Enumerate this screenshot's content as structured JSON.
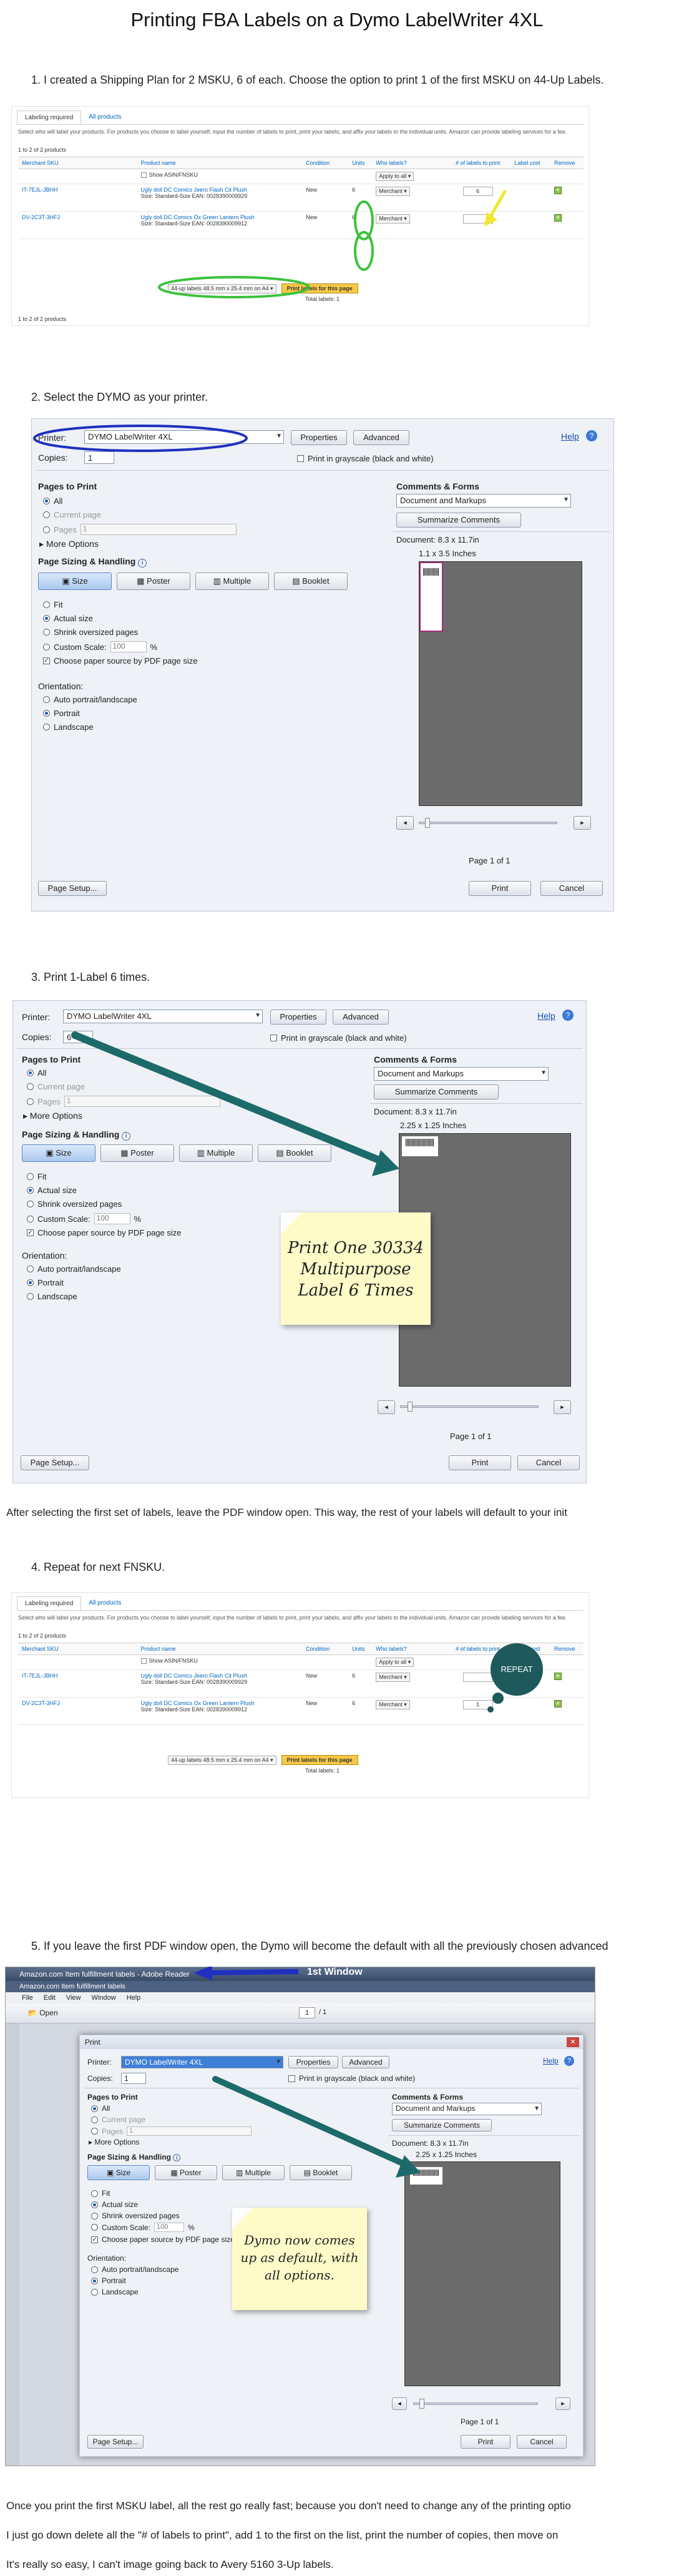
{
  "page": {
    "title": "Printing FBA Labels on a Dymo LabelWriter 4XL"
  },
  "steps": [
    "1.   I created a Shipping Plan for 2 MSKU, 6 of each. Choose the option to print 1 of the first MSKU on 44-Up Labels.",
    "2.   Select the DYMO as your printer.",
    "3.   Print 1-Label 6 times.",
    "4.   Repeat for next FNSKU.",
    "5.   If you leave the first PDF window open, the Dymo will become the default with all the previously chosen advanced"
  ],
  "paragraphs": {
    "after_step3": "After selecting the first set of labels, leave the PDF window open. This way, the rest of your labels will default to your init",
    "closing_1": "Once you print the first MSKU label, all the rest go really fast; because you don't need to change any of the printing optio",
    "closing_2": "I just go down delete all the \"# of labels to print\", add 1 to the first on the list, print the number of copies, then move on",
    "closing_3": "It's really so easy, I can't image going back to Avery 5160 3-Up labels."
  },
  "amazon": {
    "tab_labeling": "Labeling required",
    "tab_all": "All products",
    "description": "Select who will label your products. For products you choose to label yourself, input the number of labels to print, print your labels, and affix your labels to the individual units. Amazon can provide labeling services for a fee.",
    "count": "1 to 2 of 2 products",
    "headers": [
      "Merchant SKU",
      "Product name",
      "Condition",
      "Units",
      "Who labels?",
      "# of labels to print",
      "Label cost",
      "Remove"
    ],
    "show_asin": "Show ASIN/FNSKU",
    "apply_all": "Apply to all",
    "rows": [
      {
        "sku": "IT-7EJL-JBHH",
        "name": "Ugly doll DC Comics Jeero Flash Cit Plush",
        "size": "Size: Standard-Size EAN: 0028390009929",
        "condition": "New",
        "units": "6",
        "who": "Merchant",
        "labels_a": "6",
        "labels_b": "1"
      },
      {
        "sku": "DV-2C3T-3HFJ",
        "name": "Ugly doll DC Comics Ox Green Lantern Plush",
        "size": "Size: Standard-Size EAN: 0028390009912",
        "condition": "New",
        "units": "6",
        "who": "Merchant",
        "labels_a": "",
        "labels_b": "1"
      }
    ],
    "label_format": "44-up labels 48.5 mm x 25.4 mm on A4",
    "print_btn": "Print labels for this page",
    "total": "Total labels: 1",
    "total_b": "Total labels: 1",
    "footer": "1 to 2 of 2 products"
  },
  "dialog": {
    "printer_label": "Printer:",
    "printer_value": "DYMO LabelWriter 4XL",
    "properties": "Properties",
    "advanced": "Advanced",
    "help": "Help",
    "copies_label": "Copies:",
    "copies_step2": "1",
    "copies_step3": "6",
    "copies_step5": "1",
    "grayscale": "Print in grayscale (black and white)",
    "pages_to_print": "Pages to Print",
    "all": "All",
    "current_page": "Current page",
    "pages": "Pages",
    "pages_value": "1",
    "more_options": "More Options",
    "sizing": "Page Sizing & Handling",
    "size": "Size",
    "poster": "Poster",
    "multiple": "Multiple",
    "booklet": "Booklet",
    "fit": "Fit",
    "actual_size": "Actual size",
    "shrink": "Shrink oversized pages",
    "custom_scale": "Custom Scale:",
    "scale_value": "100",
    "percent": "%",
    "choose_source": "Choose paper source by PDF page size",
    "orientation": "Orientation:",
    "auto": "Auto portrait/landscape",
    "portrait": "Portrait",
    "landscape": "Landscape",
    "comments_forms": "Comments & Forms",
    "doc_markups": "Document and Markups",
    "summarize": "Summarize Comments",
    "doc_size": "Document: 8.3 x 11.7in",
    "paper_size_2": "1.1 x 3.5 Inches",
    "paper_size_3": "2.25 x 1.25 Inches",
    "page_of": "Page 1 of 1",
    "page_setup": "Page Setup...",
    "print": "Print",
    "cancel": "Cancel",
    "print_title": "Print"
  },
  "notes": {
    "step3": "Print One 30334 Multipurpose Label 6 Times",
    "step5": "Dymo now comes up as default, with all options.",
    "repeat": "REPEAT"
  },
  "reader": {
    "window_title": "Amazon.com Item fulfillment labels - Adobe Reader",
    "first_window": "1st Window",
    "sub_title": "Amazon.com Item fulfillment labels",
    "menu": [
      "File",
      "Edit",
      "View",
      "Window",
      "Help"
    ],
    "open": "Open",
    "page_box": "1",
    "page_total": "/ 1"
  },
  "colors": {
    "highlight_blue": "#1f2fc0",
    "highlight_green": "#3cc23c",
    "arrow_teal": "#1d6a6a",
    "note_yellow": "#fffbc8",
    "repeat_bubble": "#1e5a5c"
  }
}
